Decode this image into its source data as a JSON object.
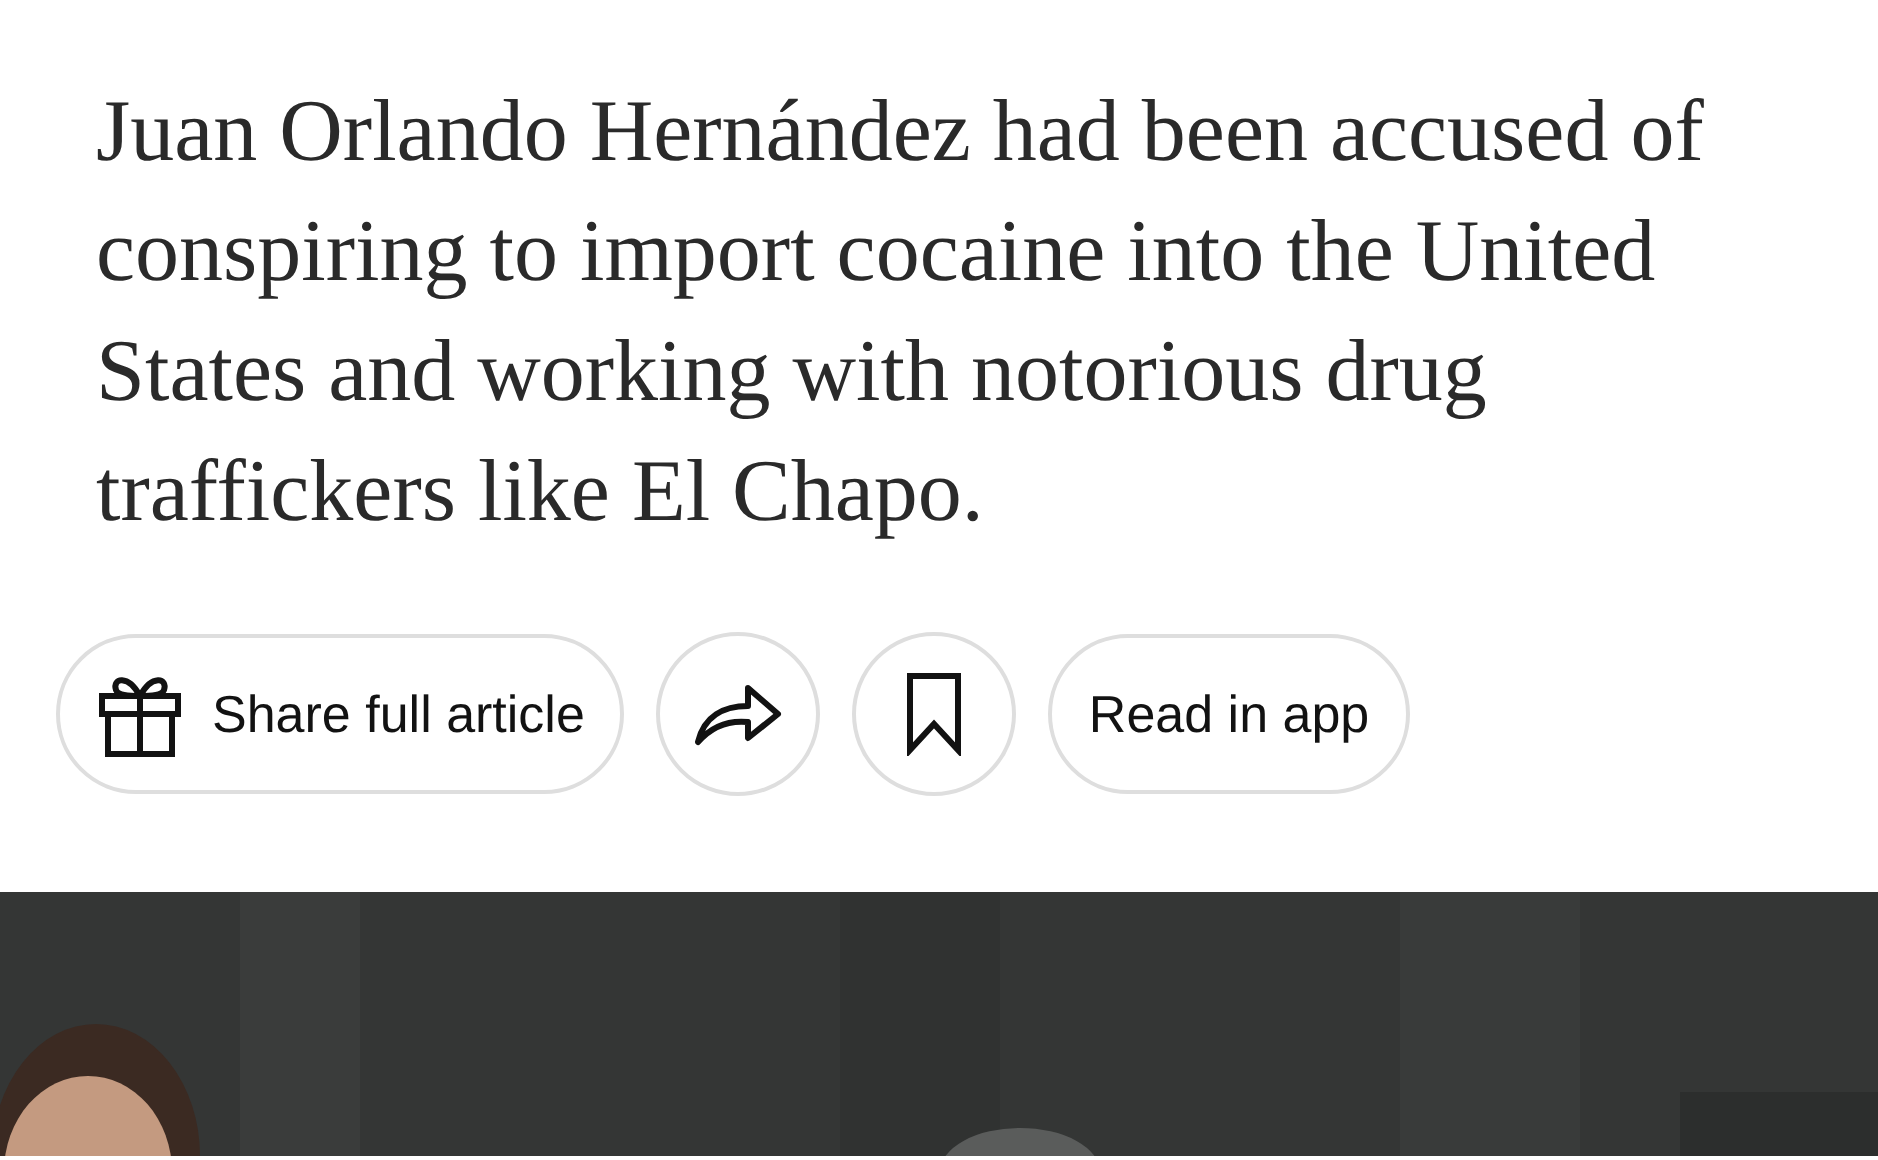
{
  "summary": "Juan Orlando Hernández had been accused of conspiring to import cocaine into the United States and working with notorious drug traffickers like El Chapo.",
  "actions": [
    {
      "kind": "share",
      "label": "Share full article"
    },
    {
      "kind": "forward"
    },
    {
      "kind": "bookmark"
    },
    {
      "kind": "app",
      "label": "Read in app"
    }
  ]
}
